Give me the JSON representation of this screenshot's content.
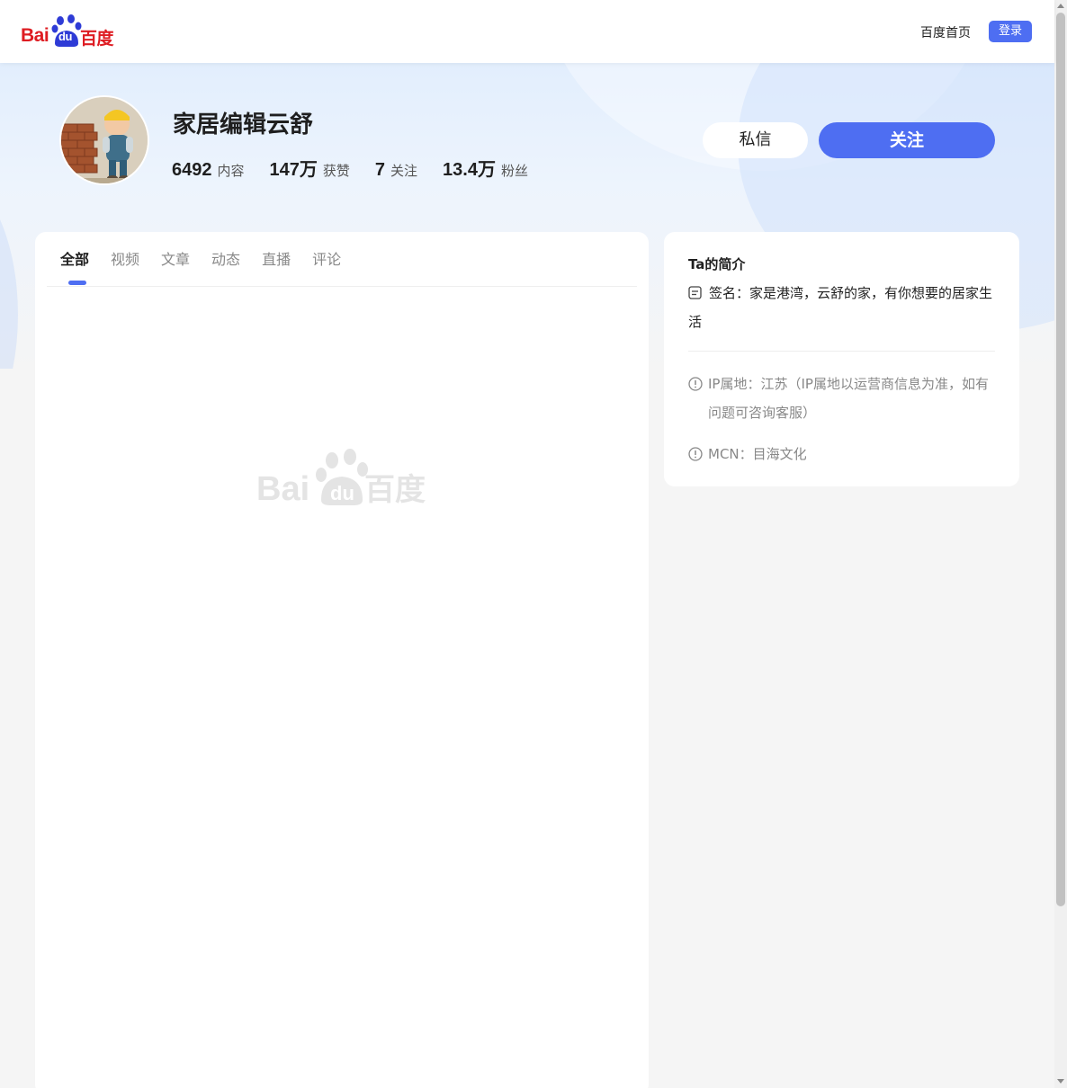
{
  "nav": {
    "logo_text_latin": "Bai",
    "logo_text_du": "du",
    "logo_text_cn": "百度",
    "home_label": "百度首页",
    "login_label": "登录"
  },
  "profile": {
    "nickname": "家居编辑云舒",
    "stats": [
      {
        "value": "6492",
        "label": "内容"
      },
      {
        "value": "147万",
        "label": "获赞"
      },
      {
        "value": "7",
        "label": "关注"
      },
      {
        "value": "13.4万",
        "label": "粉丝"
      }
    ],
    "message_label": "私信",
    "follow_label": "关注"
  },
  "tabs": [
    {
      "label": "全部",
      "active": true
    },
    {
      "label": "视频",
      "active": false
    },
    {
      "label": "文章",
      "active": false
    },
    {
      "label": "动态",
      "active": false
    },
    {
      "label": "直播",
      "active": false
    },
    {
      "label": "评论",
      "active": false
    }
  ],
  "intro": {
    "title": "Ta的简介",
    "signature": "签名：家是港湾，云舒的家，有你想要的居家生活",
    "ip": "IP属地：江苏（IP属地以运营商信息为准，如有问题可咨询客服）",
    "mcn": "MCN：目海文化"
  },
  "colors": {
    "brand_blue": "#4e6ef2",
    "logo_red": "#de1c22",
    "logo_blue": "#2e3bd6"
  }
}
